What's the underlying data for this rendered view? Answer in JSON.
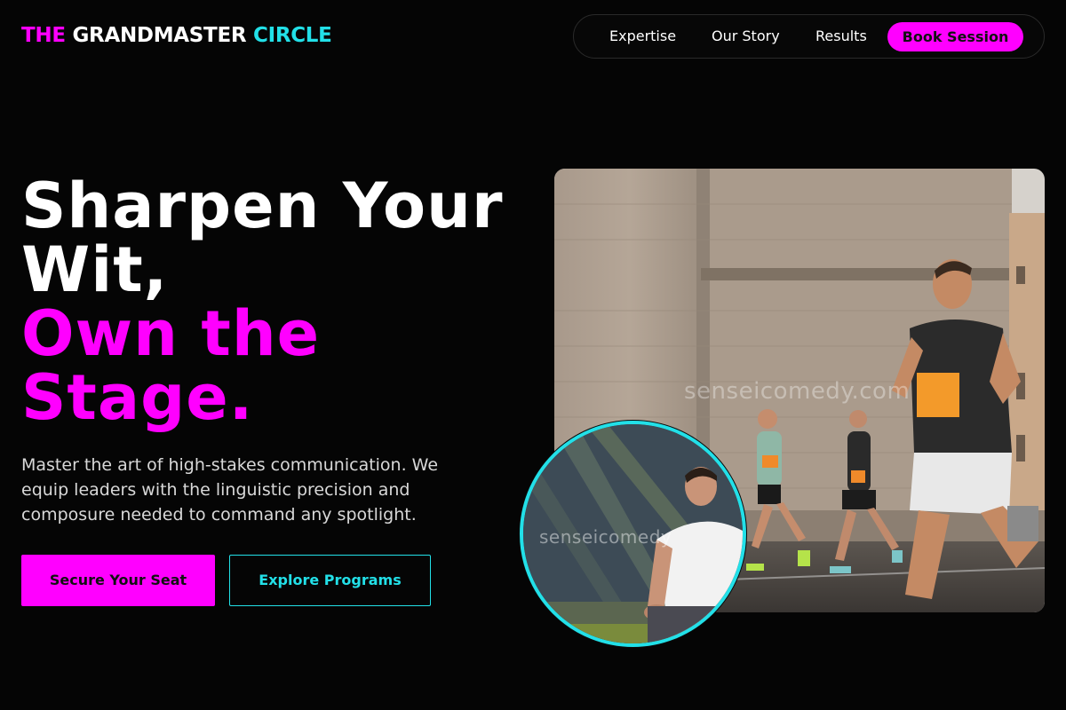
{
  "brand": {
    "part1": "THE",
    "part2": "GRANDMASTER",
    "part3": "CIRCLE"
  },
  "nav": {
    "items": [
      {
        "label": "Expertise"
      },
      {
        "label": "Our Story"
      },
      {
        "label": "Results"
      }
    ],
    "cta_label": "Book Session"
  },
  "hero": {
    "headline_line1": "Sharpen Your",
    "headline_line2": "Wit,",
    "headline_line3": "Own the",
    "headline_line4": "Stage.",
    "lead": "Master the art of high-stakes communication. We equip leaders with the linguistic precision and composure needed to command any spotlight.",
    "primary_button": "Secure Your Seat",
    "secondary_button": "Explore Programs",
    "photo_watermark": "senseicomedy.com",
    "circle_watermark": "senseicomedy"
  },
  "colors": {
    "background": "#050505",
    "accent_pink": "#ff00ff",
    "accent_cyan": "#22e0e8"
  }
}
